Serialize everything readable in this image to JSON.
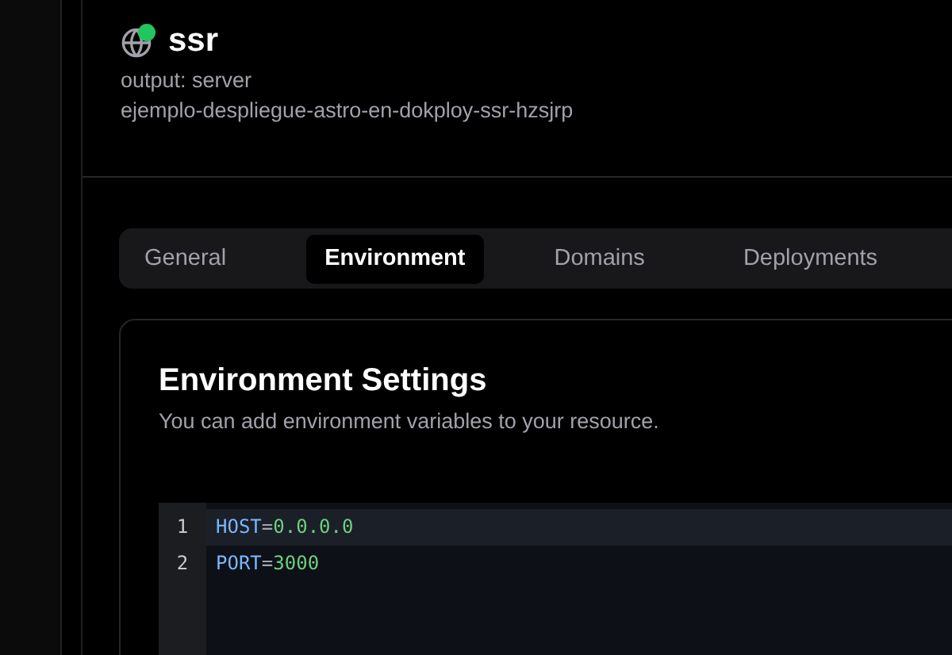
{
  "service": {
    "name": "ssr",
    "online": true,
    "output": "output: server",
    "app_id": "ejemplo-despliegue-astro-en-dokploy-ssr-hzsjrp"
  },
  "tabs": [
    {
      "label": "General",
      "selected": false
    },
    {
      "label": "Environment",
      "selected": true
    },
    {
      "label": "Domains",
      "selected": false
    },
    {
      "label": "Deployments",
      "selected": false
    }
  ],
  "card": {
    "title": "Environment Settings",
    "description": "You can add environment variables to your resource."
  },
  "editor": {
    "lines": [
      {
        "number": "1",
        "key": "HOST",
        "sep": "=",
        "value": "0.0.0.0",
        "active": true
      },
      {
        "number": "2",
        "key": "PORT",
        "sep": "=",
        "value": "3000",
        "active": false
      }
    ]
  }
}
